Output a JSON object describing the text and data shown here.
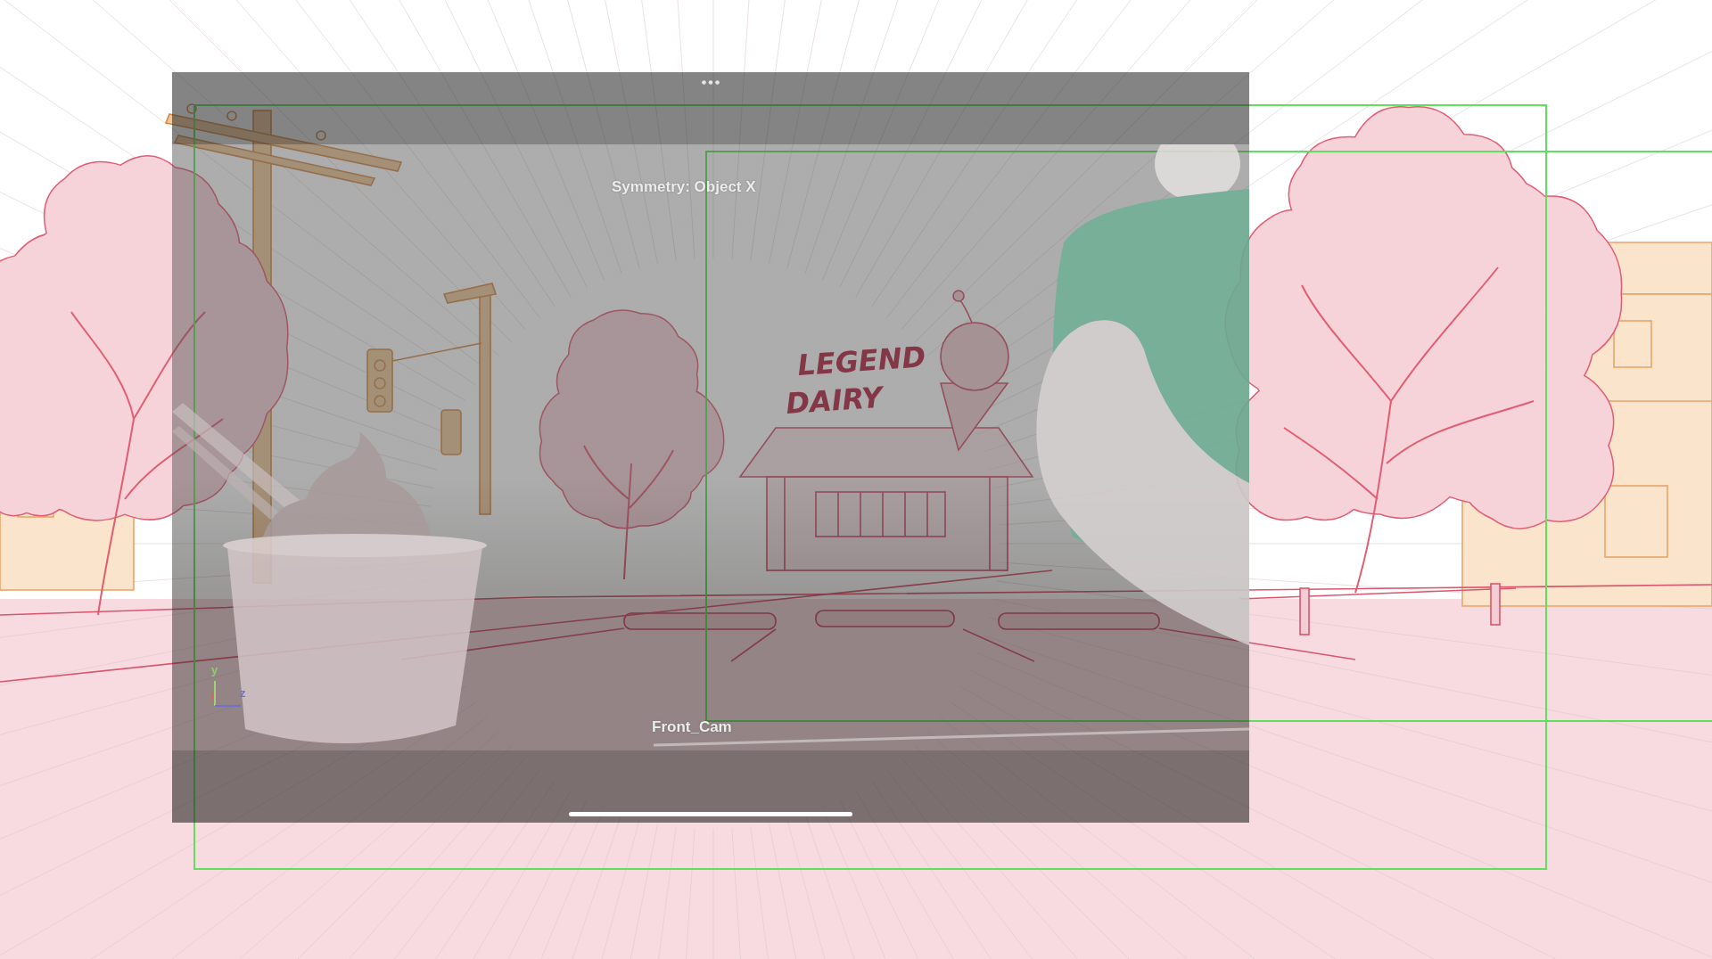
{
  "scene": {
    "shop_sign": [
      "LEGEND",
      "DAIRY"
    ]
  },
  "viewport": {
    "symmetry_label": "Symmetry: Object X",
    "camera_label": "Front_Cam",
    "axis_labels": [
      {
        "label": "y",
        "color": "#8fce6a"
      },
      {
        "label": "z",
        "color": "#6f6fd6"
      }
    ]
  }
}
